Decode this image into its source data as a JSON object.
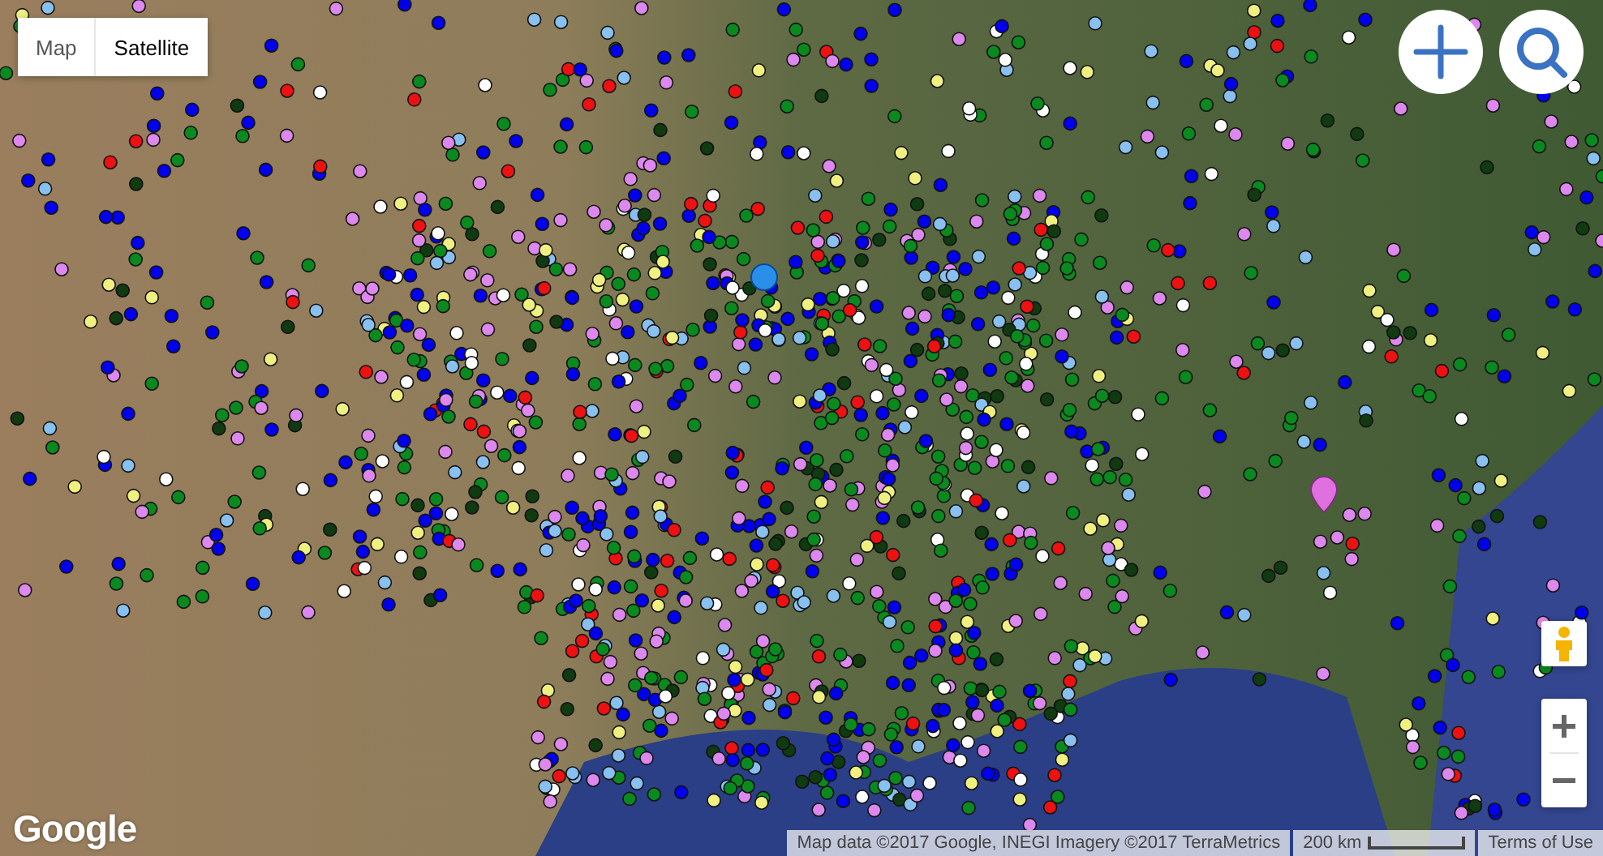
{
  "map_type_control": [
    {
      "label": "Map",
      "selected": false
    },
    {
      "label": "Satellite",
      "selected": true
    }
  ],
  "logo": "Google",
  "attribution": {
    "map_data": "Map data ©2017 Google, INEGI Imagery ©2017 TerraMetrics",
    "scale": "200 km",
    "terms": "Terms of Use"
  }
}
